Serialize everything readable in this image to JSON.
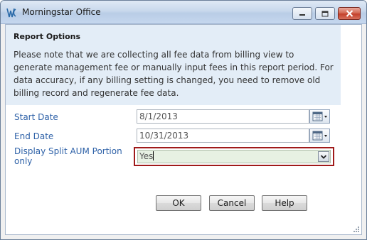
{
  "window": {
    "title": "Morningstar Office",
    "controls": {
      "minimize_icon": "minimize-icon",
      "maximize_icon": "maximize-icon",
      "close_icon": "close-icon",
      "close_color": "#c4412c"
    }
  },
  "info": {
    "title": "Report Options",
    "text": "Please note that we are collecting all fee data from billing view to generate management fee or manually input fees in this report period. For data accuracy, if any billing setting is changed, you need to remove old billing record and regenerate fee data."
  },
  "form": {
    "start_date": {
      "label": "Start Date",
      "value": "8/1/2013",
      "icon": "calendar-icon"
    },
    "end_date": {
      "label": "End Date",
      "value": "10/31/2013",
      "icon": "calendar-icon"
    },
    "split_aum": {
      "label": "Display Split AUM Portion only",
      "value": "Yes",
      "icon": "chevron-down-icon"
    }
  },
  "buttons": {
    "ok": "OK",
    "cancel": "Cancel",
    "help": "Help"
  },
  "colors": {
    "label": "#2f62a8",
    "info_background": "#e3edf7",
    "highlight_border": "#a01a1a",
    "combo_background": "#e7f1e3"
  }
}
